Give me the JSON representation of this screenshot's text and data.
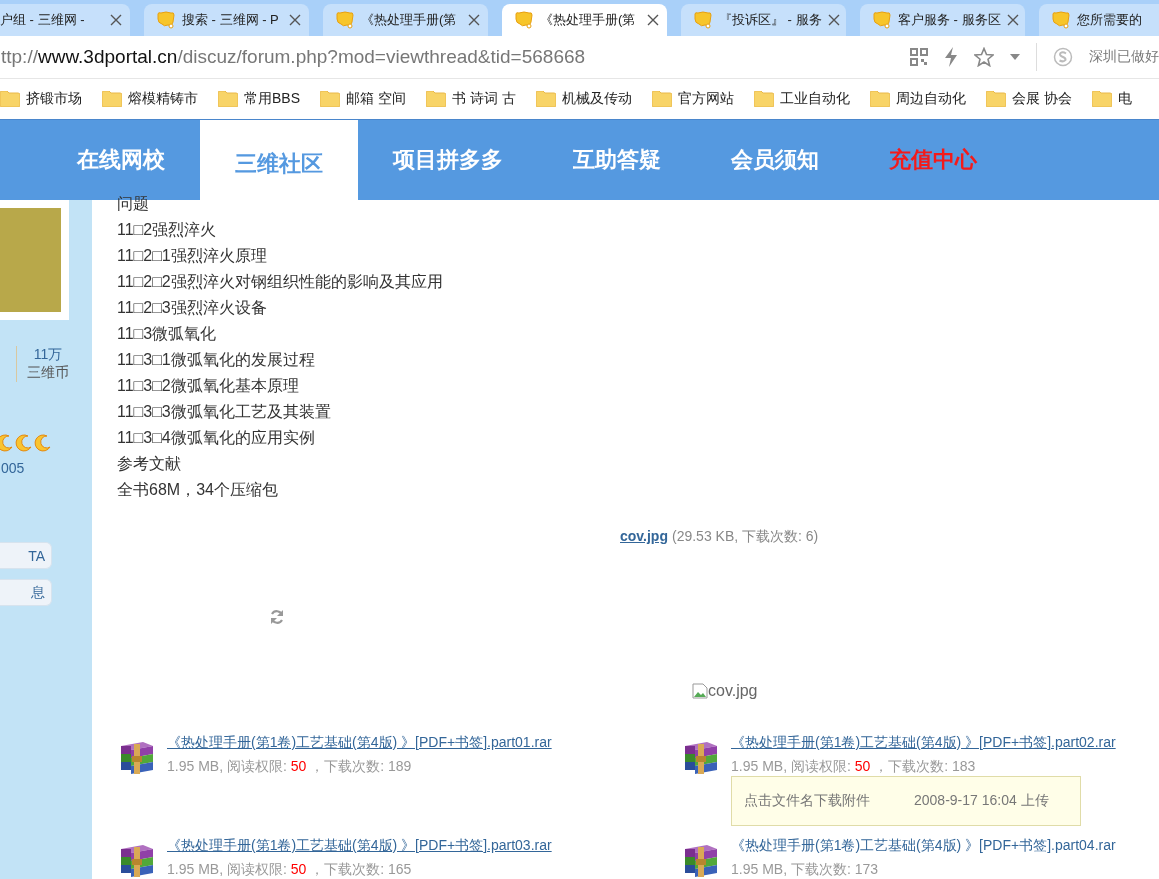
{
  "tabs": [
    {
      "title": "户组 - 三维网 -",
      "selected": false,
      "icon": false
    },
    {
      "title": "搜索 - 三维网 - P",
      "selected": false,
      "icon": true
    },
    {
      "title": "《热处理手册(第",
      "selected": false,
      "icon": true
    },
    {
      "title": "《热处理手册(第",
      "selected": true,
      "icon": true
    },
    {
      "title": "『投诉区』 - 服务",
      "selected": false,
      "icon": true
    },
    {
      "title": "客户服务 - 服务区",
      "selected": false,
      "icon": true
    },
    {
      "title": "您所需要的",
      "selected": false,
      "icon": true
    }
  ],
  "address": {
    "scheme": "ttp://",
    "host": "www.3dportal.cn",
    "path": "/discuz/forum.php?mod=viewthread&tid=568668"
  },
  "search_hint": "深圳已做好",
  "bookmarks": [
    "挤锻市场",
    "熔模精铸市",
    "常用BBS",
    "邮箱 空间",
    "书 诗词 古",
    "机械及传动",
    "官方网站",
    "工业自动化",
    "周边自动化",
    "会展 协会",
    "电"
  ],
  "nav": [
    {
      "label": "在线网校",
      "selected": false,
      "highlight": false
    },
    {
      "label": "三维社区",
      "selected": true,
      "highlight": false
    },
    {
      "label": "项目拼多多",
      "selected": false,
      "highlight": false
    },
    {
      "label": "互助答疑",
      "selected": false,
      "highlight": false
    },
    {
      "label": "会员须知",
      "selected": false,
      "highlight": false
    },
    {
      "label": "充值中心",
      "selected": false,
      "highlight": true
    }
  ],
  "profile": {
    "stat_value": "11万",
    "stat_label": "三维币",
    "rank_id": "005",
    "buttons": [
      "TA",
      "息"
    ]
  },
  "content_lines": [
    "问题",
    "11□2强烈淬火",
    "11□2□1强烈淬火原理",
    "11□2□2强烈淬火对钢组织性能的影响及其应用",
    "11□2□3强烈淬火设备",
    "11□3微弧氧化",
    "11□3□1微弧氧化的发展过程",
    "11□3□2微弧氧化基本原理",
    "11□3□3微弧氧化工艺及其装置",
    "11□3□4微弧氧化的应用实例",
    "参考文献",
    "全书68M，34个压缩包"
  ],
  "image_attachment": {
    "name": "cov.jpg",
    "details": "(29.53 KB, 下载次数: 6)",
    "alt": "cov.jpg"
  },
  "attachments": [
    {
      "name": "《热处理手册(第1卷)工艺基础(第4版) 》[PDF+书签].part01.rar",
      "size_text": "1.95 MB, ",
      "permission_label": "阅读权限: ",
      "permission": "50",
      "downloads_text": " ，下载次数: 189"
    },
    {
      "name": "《热处理手册(第1卷)工艺基础(第4版) 》[PDF+书签].part02.rar",
      "size_text": "1.95 MB, ",
      "permission_label": "阅读权限: ",
      "permission": "50",
      "downloads_text": " ，下载次数: 183",
      "tooltip": {
        "hint": "点击文件名下载附件",
        "time": "2008-9-17 16:04 上传"
      }
    },
    {
      "name": "《热处理手册(第1卷)工艺基础(第4版) 》[PDF+书签].part03.rar",
      "size_text": "1.95 MB, ",
      "permission_label": "阅读权限: ",
      "permission": "50",
      "downloads_text": " ，下载次数: 165"
    },
    {
      "name": "《热处理手册(第1卷)工艺基础(第4版) 》[PDF+书签].part04.rar",
      "size_text": "1.95 MB, ",
      "downloads_text": "下载次数: 173"
    }
  ]
}
